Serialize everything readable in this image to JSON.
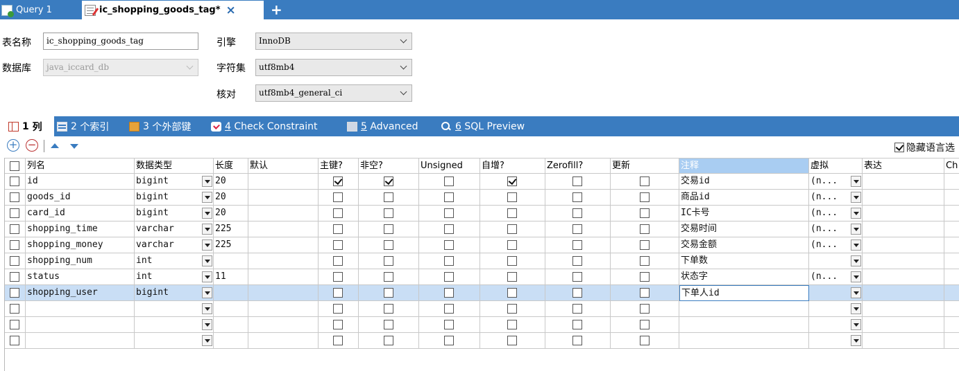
{
  "tabs": [
    {
      "label": "Query 1",
      "active": false
    },
    {
      "label": "ic_shopping_goods_tag*",
      "active": true
    }
  ],
  "tab_close": "×",
  "tab_add": "+",
  "form": {
    "table_name_label": "表名称",
    "table_name_value": "ic_shopping_goods_tag",
    "database_label": "数据库",
    "database_value": "java_iccard_db",
    "engine_label": "引擎",
    "engine_value": "InnoDB",
    "charset_label": "字符集",
    "charset_value": "utf8mb4",
    "collation_label": "核对",
    "collation_value": "utf8mb4_general_ci"
  },
  "sections": [
    {
      "num": "1",
      "label": "列"
    },
    {
      "num": "2",
      "label": "个索引"
    },
    {
      "num": "3",
      "label": "个外部键"
    },
    {
      "num": "4",
      "label": "Check Constraint"
    },
    {
      "num": "5",
      "label": "Advanced"
    },
    {
      "num": "6",
      "label": "SQL Preview"
    }
  ],
  "toolbar": {
    "add_symbol": "+",
    "remove_symbol": "−",
    "hide_language_label": "隐藏语言选",
    "hide_language_checked": true
  },
  "columns": [
    "列名",
    "数据类型",
    "长度",
    "默认",
    "主键?",
    "非空?",
    "Unsigned",
    "自增?",
    "Zerofill?",
    "更新",
    "注释",
    "虚拟",
    "表达",
    "Ch"
  ],
  "rows": [
    {
      "name": "id",
      "type": "bigint",
      "length": "20",
      "pk": true,
      "nn": true,
      "unsigned": false,
      "ai": true,
      "zerofill": false,
      "update": false,
      "comment": "交易id",
      "virtual": "(n..."
    },
    {
      "name": "goods_id",
      "type": "bigint",
      "length": "20",
      "pk": false,
      "nn": false,
      "unsigned": false,
      "ai": false,
      "zerofill": false,
      "update": false,
      "comment": "商品id",
      "virtual": "(n..."
    },
    {
      "name": "card_id",
      "type": "bigint",
      "length": "20",
      "pk": false,
      "nn": false,
      "unsigned": false,
      "ai": false,
      "zerofill": false,
      "update": false,
      "comment": "IC卡号",
      "virtual": "(n..."
    },
    {
      "name": "shopping_time",
      "type": "varchar",
      "length": "225",
      "pk": false,
      "nn": false,
      "unsigned": false,
      "ai": false,
      "zerofill": false,
      "update": false,
      "comment": "交易时间",
      "virtual": "(n..."
    },
    {
      "name": "shopping_money",
      "type": "varchar",
      "length": "225",
      "pk": false,
      "nn": false,
      "unsigned": false,
      "ai": false,
      "zerofill": false,
      "update": false,
      "comment": "交易金额",
      "virtual": "(n..."
    },
    {
      "name": "shopping_num",
      "type": "int",
      "length": "",
      "pk": false,
      "nn": false,
      "unsigned": false,
      "ai": false,
      "zerofill": false,
      "update": false,
      "comment": "下单数",
      "virtual": ""
    },
    {
      "name": "status",
      "type": "int",
      "length": "11",
      "pk": false,
      "nn": false,
      "unsigned": false,
      "ai": false,
      "zerofill": false,
      "update": false,
      "comment": "状态字",
      "virtual": "(n..."
    },
    {
      "name": "shopping_user",
      "type": "bigint",
      "length": "",
      "pk": false,
      "nn": false,
      "unsigned": false,
      "ai": false,
      "zerofill": false,
      "update": false,
      "comment": "下单人id",
      "virtual": "",
      "selected": true
    },
    {
      "name": "",
      "type": "",
      "length": "",
      "pk": false,
      "nn": false,
      "unsigned": false,
      "ai": false,
      "zerofill": false,
      "update": false,
      "comment": "",
      "virtual": ""
    },
    {
      "name": "",
      "type": "",
      "length": "",
      "pk": false,
      "nn": false,
      "unsigned": false,
      "ai": false,
      "zerofill": false,
      "update": false,
      "comment": "",
      "virtual": ""
    },
    {
      "name": "",
      "type": "",
      "length": "",
      "pk": false,
      "nn": false,
      "unsigned": false,
      "ai": false,
      "zerofill": false,
      "update": false,
      "comment": "",
      "virtual": ""
    }
  ],
  "colors": {
    "accent": "#3a7cc0",
    "selected_row": "#c9def5",
    "header_highlight": "#a9cdf2"
  }
}
